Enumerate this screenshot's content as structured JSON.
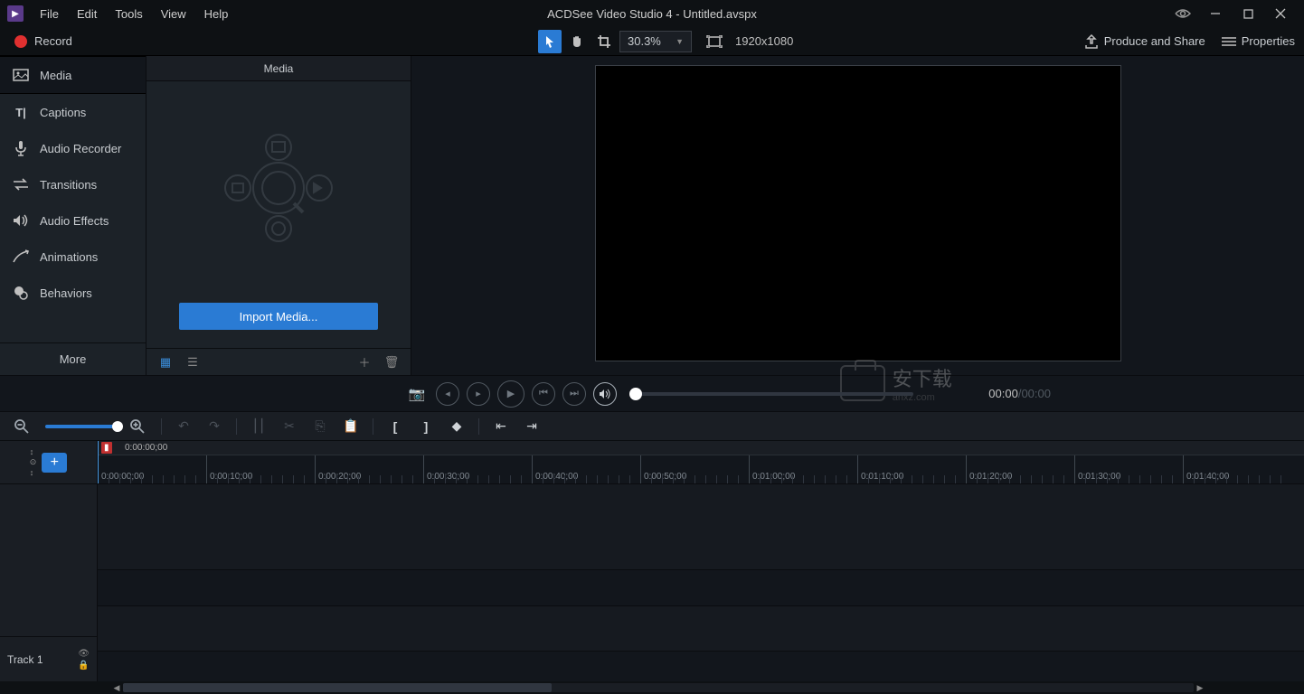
{
  "title": "ACDSee Video Studio 4 - Untitled.avspx",
  "menu": [
    "File",
    "Edit",
    "Tools",
    "View",
    "Help"
  ],
  "toolbar": {
    "record": "Record",
    "zoom": "30.3%",
    "resolution": "1920x1080",
    "produce": "Produce and Share",
    "properties": "Properties"
  },
  "sidebar": {
    "items": [
      "Media",
      "Captions",
      "Audio Recorder",
      "Transitions",
      "Audio Effects",
      "Animations",
      "Behaviors"
    ],
    "more": "More"
  },
  "media": {
    "tab": "Media",
    "import": "Import Media..."
  },
  "playback": {
    "current": "00:00",
    "total": "00:00"
  },
  "timeline": {
    "playhead": "0:00:00;00",
    "ticks": [
      "0:00:00;00",
      "0:00:10;00",
      "0:00:20;00",
      "0:00:30;00",
      "0:00:40;00",
      "0:00:50;00",
      "0:01:00;00",
      "0:01:10;00",
      "0:01:20;00",
      "0:01:30;00",
      "0:01:40;00"
    ],
    "track1": "Track 1"
  },
  "watermark": {
    "brand": "安下载",
    "sub": "anxz.com"
  }
}
